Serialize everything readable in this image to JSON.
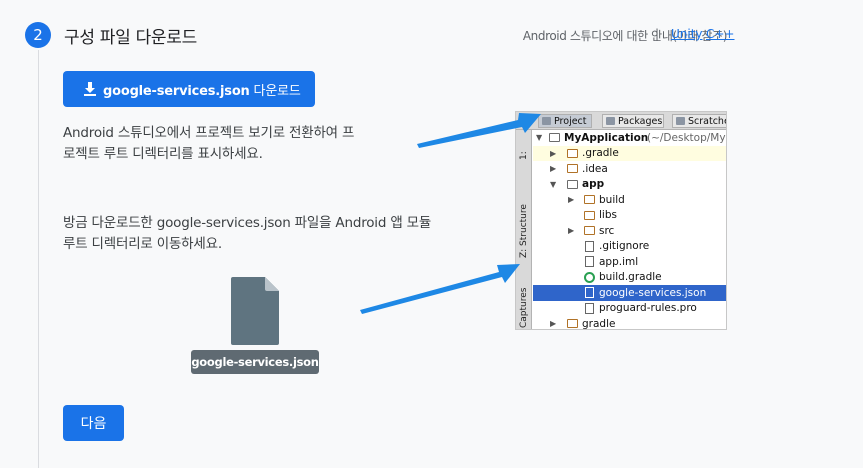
{
  "step": {
    "number": "2",
    "title": "구성 파일 다운로드"
  },
  "header_links": {
    "guide_text": "Android 스튜디오에 대한 안내(아래 참조)",
    "separator": "|",
    "unity": "Unity",
    "cpp": "C++"
  },
  "download_button": {
    "filename": "google-services.json",
    "suffix": " 다운로드"
  },
  "paragraph1": {
    "line1": "Android 스튜디오에서 프로젝트 보기로 전환하여 프",
    "line2": "로젝트 루트 디렉터리를 표시하세요."
  },
  "paragraph2": {
    "line1": "방금 다운로드한 google-services.json 파일을 Android 앱 모듈",
    "line2": "루트 디렉터리로 이동하세요."
  },
  "file_label": "google-services.json",
  "next_button": "다음",
  "ide": {
    "tabs": [
      "Project",
      "Packages",
      "Scratches"
    ],
    "side_tabs": [
      "1:",
      "Z: Structure",
      "Captures"
    ],
    "tree": [
      {
        "label": "MyApplication",
        "suffix": " (~/Desktop/My",
        "bold": true,
        "icon": "project-folder-icon"
      },
      {
        "label": ".gradle",
        "icon": "folder-icon"
      },
      {
        "label": ".idea",
        "icon": "folder-icon"
      },
      {
        "label": "app",
        "bold": true,
        "icon": "module-folder-icon"
      },
      {
        "label": "build",
        "icon": "folder-icon"
      },
      {
        "label": "libs",
        "icon": "folder-icon"
      },
      {
        "label": "src",
        "icon": "folder-icon"
      },
      {
        "label": ".gitignore",
        "icon": "file-icon"
      },
      {
        "label": "app.iml",
        "icon": "file-icon"
      },
      {
        "label": "build.gradle",
        "icon": "gradle-icon"
      },
      {
        "label": "google-services.json",
        "icon": "json-file-icon"
      },
      {
        "label": "proguard-rules.pro",
        "icon": "file-icon"
      },
      {
        "label": "gradle",
        "icon": "folder-icon"
      }
    ]
  },
  "colors": {
    "accent": "#1a73e8",
    "selection": "#2f65ca",
    "arrow": "#1e88e5"
  }
}
